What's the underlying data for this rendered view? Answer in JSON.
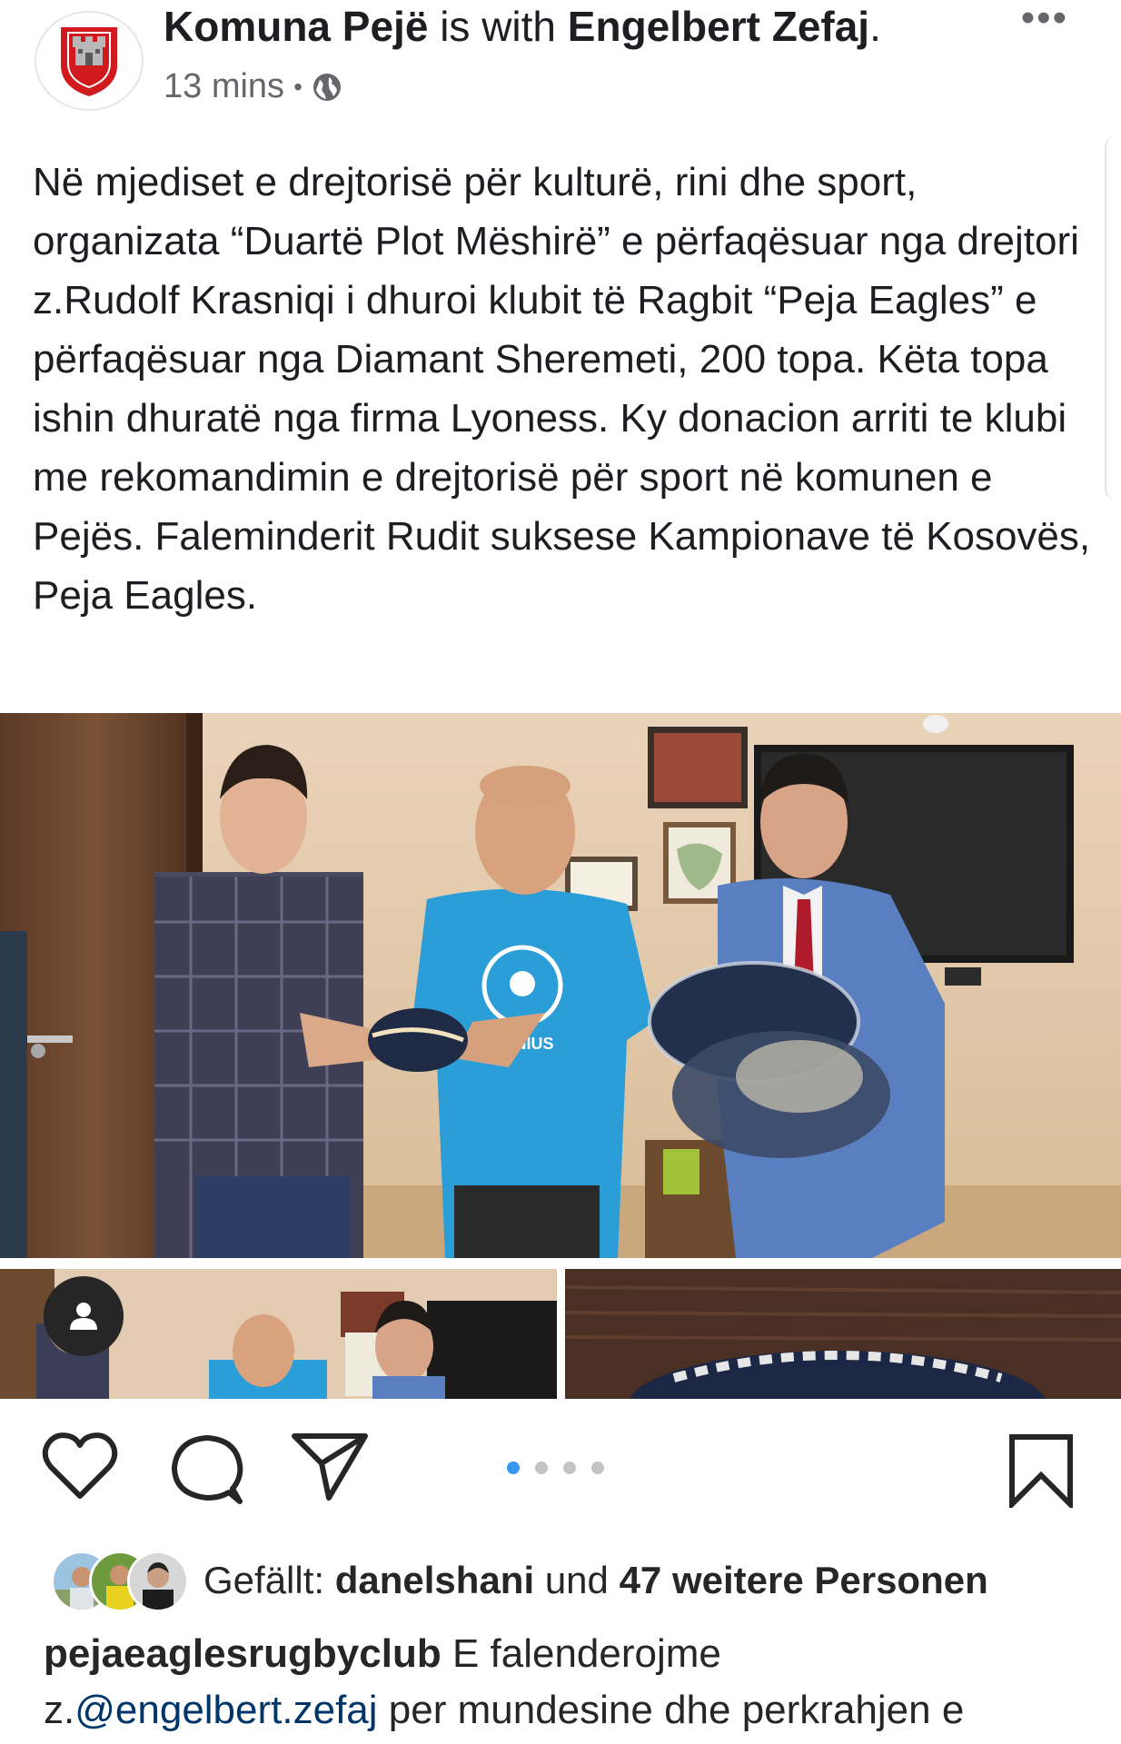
{
  "post": {
    "page_name": "Komuna Pejë",
    "with_text": "is with",
    "tagged_person": "Engelbert Zefaj",
    "tagged_suffix": ".",
    "time": "13 mins",
    "separator": "•",
    "privacy_icon": "globe-icon",
    "more_icon": "more-dots-icon",
    "more_label": "•••",
    "text": "Në mjediset e drejtorisë për kulturë, rini dhe sport, organizata “Duartë Plot Mëshirë” e përfaqësuar nga drejtori z.Rudolf Krasniqi i dhuroi klubit të Ragbit “Peja Eagles” e përfaqësuar nga Diamant Sheremeti, 200 topa. Këta topa ishin dhuratë nga firma Lyoness. Ky donacion arriti te klubi me rekomandimin e drejtorisë për sport në komunen e Pejës. Faleminderit Rudit suksese Kampionave të Kosovës, Peja Eagles."
  },
  "photo": {
    "shirt_text": "GENIUS"
  },
  "actions": {
    "like_icon": "heart-icon",
    "comment_icon": "comment-icon",
    "share_icon": "paper-plane-icon",
    "save_icon": "bookmark-icon",
    "carousel_count": 4,
    "carousel_active": 1
  },
  "likes": {
    "prefix": "Gefällt:",
    "user": "danelshani",
    "middle": "und",
    "others": "47 weitere Personen"
  },
  "caption": {
    "username": "pejaeaglesrugbyclub",
    "text_line1": "E falenderojme",
    "prefix_mention": "z.",
    "mention": "@engelbert.zefaj",
    "text_after": "per  mundesine dhe perkrahjen e"
  },
  "colors": {
    "accent_blue": "#3897f0",
    "mention_blue": "#003569",
    "text": "#262626",
    "muted": "#65676b"
  }
}
